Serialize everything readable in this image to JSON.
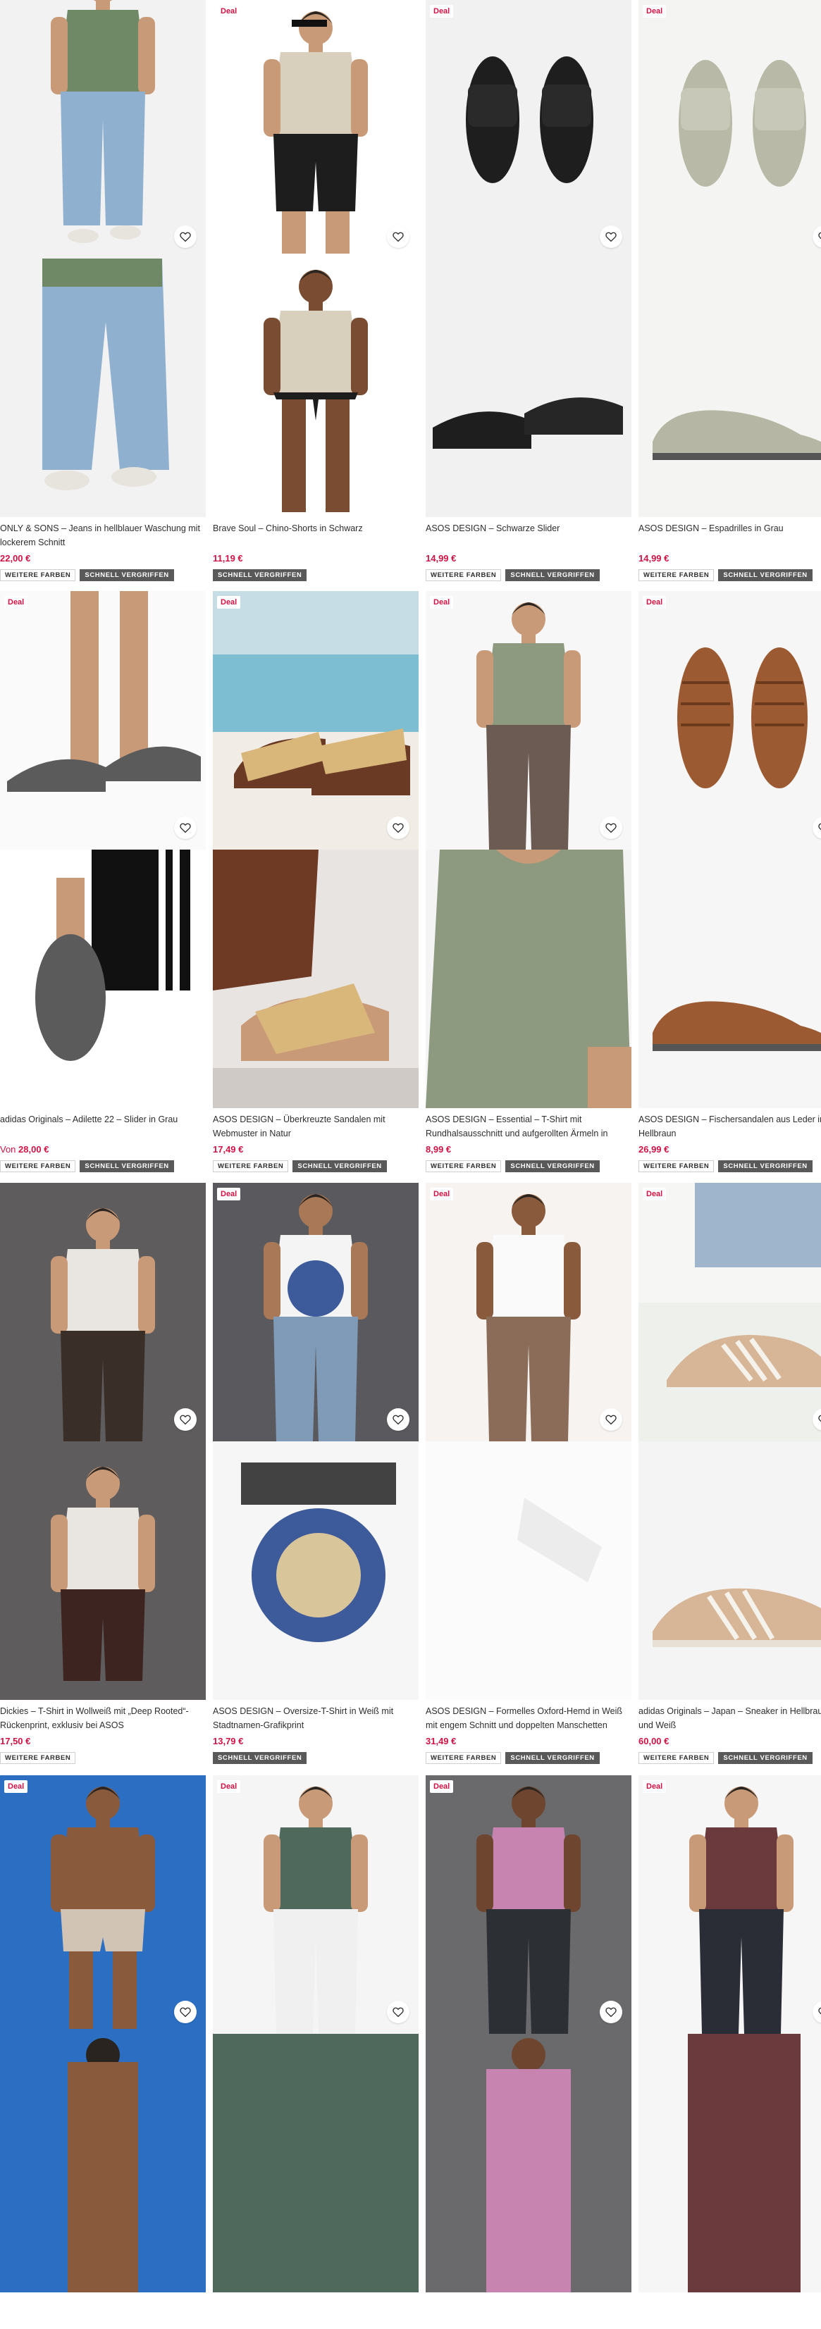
{
  "labels": {
    "deal": "Deal",
    "more_colors": "WEITERE FARBEN",
    "quick_buy": "SCHNELL VERGRIFFEN",
    "from_prefix": "Von"
  },
  "icons": {
    "wishlist": "heart-icon"
  },
  "colors": {
    "deal": "#d01345",
    "price": "#d01345",
    "quick_badge": "#595959"
  },
  "products": [
    {
      "name": "ONLY & SONS – Jeans in hellblauer Waschung mit lockerem Schnitt",
      "price": "22,00 €",
      "from": "",
      "deal": false,
      "more_colors": true,
      "quick_buy": true,
      "scene": "jeans"
    },
    {
      "name": "Brave Soul – Chino-Shorts in Schwarz",
      "price": "11,19 €",
      "from": "",
      "deal": true,
      "more_colors": false,
      "quick_buy": true,
      "scene": "shorts"
    },
    {
      "name": "ASOS DESIGN – Schwarze Slider",
      "price": "14,99 €",
      "from": "",
      "deal": true,
      "more_colors": true,
      "quick_buy": true,
      "scene": "slider"
    },
    {
      "name": "ASOS DESIGN – Espadrilles in Grau",
      "price": "14,99 €",
      "from": "",
      "deal": true,
      "more_colors": true,
      "quick_buy": true,
      "scene": "espadrille"
    },
    {
      "name": "adidas Originals – Adilette 22 – Slider in Grau",
      "price": "28,00 €",
      "from": "Von",
      "deal": true,
      "more_colors": true,
      "quick_buy": true,
      "scene": "adilette"
    },
    {
      "name": "ASOS DESIGN – Überkreuzte Sandalen mit Webmuster in Natur",
      "price": "17,49 €",
      "from": "",
      "deal": true,
      "more_colors": true,
      "quick_buy": true,
      "scene": "sandal"
    },
    {
      "name": "ASOS DESIGN – Essential – T-Shirt mit Rundhalsausschnitt und aufgerollten Ärmeln in Khaki",
      "price": "8,99 €",
      "from": "",
      "deal": true,
      "more_colors": true,
      "quick_buy": true,
      "scene": "khaki"
    },
    {
      "name": "ASOS DESIGN – Fischersandalen aus Leder in Hellbraun",
      "price": "26,99 €",
      "from": "",
      "deal": true,
      "more_colors": true,
      "quick_buy": true,
      "scene": "fisher"
    },
    {
      "name": "Dickies – T-Shirt in Wollweiß mit „Deep Rooted“-Rückenprint, exklusiv bei ASOS",
      "price": "17,50 €",
      "from": "",
      "deal": false,
      "more_colors": true,
      "quick_buy": false,
      "scene": "dickies"
    },
    {
      "name": "ASOS DESIGN – Oversize-T-Shirt in Weiß mit Stadtnamen-Grafikprint",
      "price": "13,79 €",
      "from": "",
      "deal": true,
      "more_colors": false,
      "quick_buy": true,
      "scene": "sevilla"
    },
    {
      "name": "ASOS DESIGN – Formelles Oxford-Hemd in Weiß mit engem Schnitt und doppelten Manschetten",
      "price": "31,49 €",
      "from": "",
      "deal": true,
      "more_colors": true,
      "quick_buy": true,
      "scene": "oxford"
    },
    {
      "name": "adidas Originals – Japan – Sneaker in Hellbraun und Weiß",
      "price": "60,00 €",
      "from": "",
      "deal": true,
      "more_colors": true,
      "quick_buy": true,
      "scene": "sneaker"
    },
    {
      "name": "",
      "price": "",
      "from": "",
      "deal": true,
      "more_colors": false,
      "quick_buy": false,
      "scene": "swim"
    },
    {
      "name": "",
      "price": "",
      "from": "",
      "deal": true,
      "more_colors": false,
      "quick_buy": false,
      "scene": "green"
    },
    {
      "name": "",
      "price": "",
      "from": "",
      "deal": true,
      "more_colors": false,
      "quick_buy": false,
      "scene": "pink"
    },
    {
      "name": "",
      "price": "",
      "from": "",
      "deal": true,
      "more_colors": false,
      "quick_buy": false,
      "scene": "burgundy"
    }
  ]
}
